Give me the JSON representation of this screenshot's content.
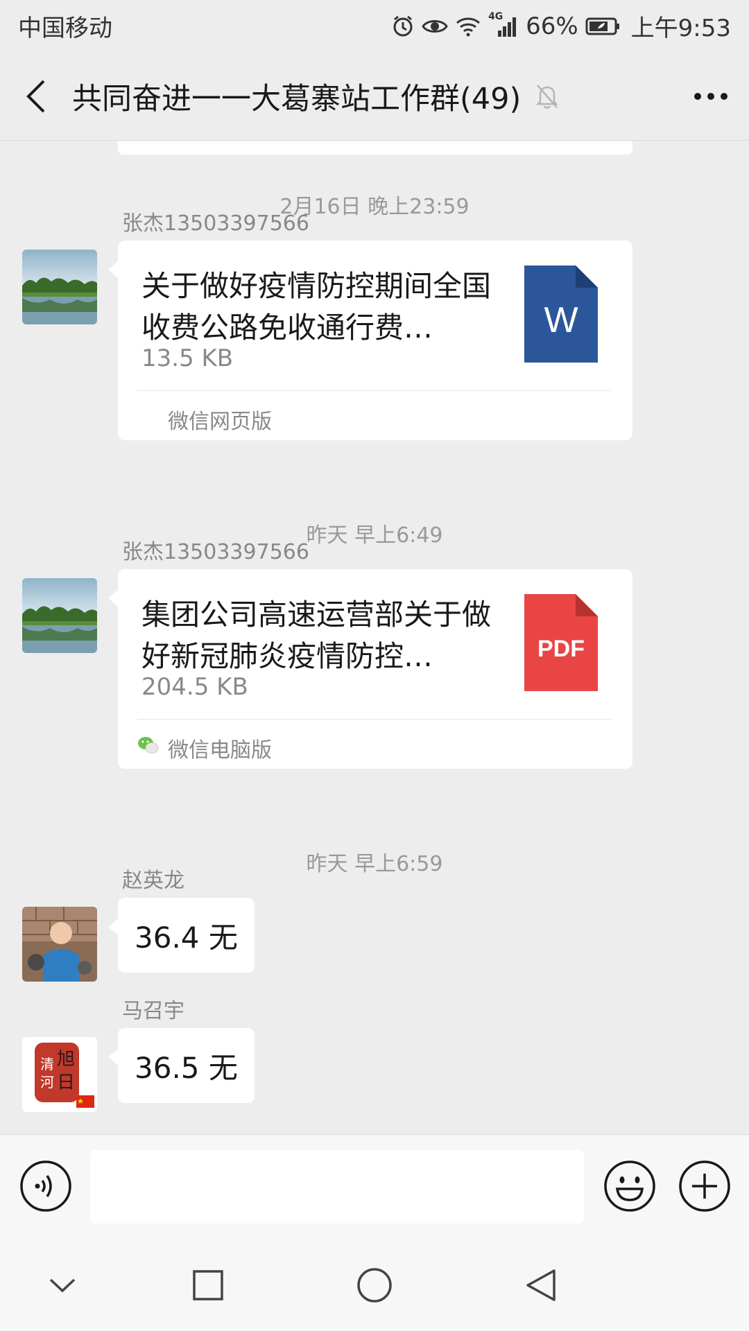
{
  "status_bar": {
    "carrier": "中国移动",
    "network": "4G",
    "battery": "66%",
    "time": "上午9:53",
    "icons": [
      "alarm-icon",
      "eye-icon",
      "wifi-icon",
      "signal-icon",
      "battery-icon"
    ]
  },
  "header": {
    "title": "共同奋进一一大葛寨站工作群(49)",
    "icons": [
      "back-arrow-icon",
      "mute-bell-icon",
      "more-dots-icon"
    ]
  },
  "messages": [
    {
      "timestamp": "2月16日 晚上23:59",
      "sender": "张杰13503397566",
      "file_title": "关于做好疫情防控期间全国收费公路免收通行费…",
      "file_size": "13.5 KB",
      "file_icon_label": "W",
      "file_icon_color": "#2b579a",
      "source": "微信网页版"
    },
    {
      "timestamp": "昨天 早上6:49",
      "sender": "张杰13503397566",
      "file_title": "集团公司高速运营部关于做好新冠肺炎疫情防控…",
      "file_size": "204.5 KB",
      "file_icon_label": "PDF",
      "file_icon_color": "#e94545",
      "source": "微信电脑版"
    },
    {
      "timestamp": "昨天 早上6:59",
      "sender": "赵英龙",
      "text": "36.4 无"
    },
    {
      "sender": "马召宇",
      "text": "36.5 无",
      "avatar_text": [
        "清",
        "河",
        "旭",
        "日"
      ]
    }
  ],
  "input": {
    "value": "",
    "placeholder": ""
  },
  "colors": {
    "background": "#ededed",
    "bubble": "#ffffff",
    "muted_text": "#888888"
  }
}
